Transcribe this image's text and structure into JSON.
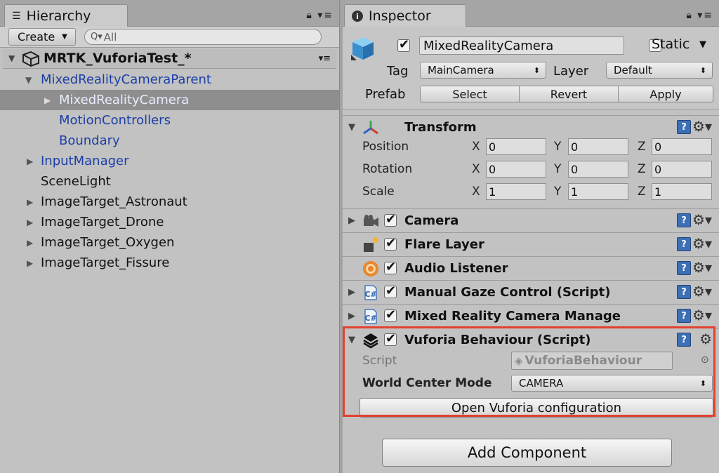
{
  "hierarchy": {
    "tab_label": "Hierarchy",
    "create_label": "Create",
    "search_placeholder": "All",
    "scene_name": "MRTK_VuforiaTest_*",
    "items": [
      {
        "label": "MixedRealityCameraParent",
        "expanded": true
      },
      {
        "label": "MixedRealityCamera",
        "selected": true
      },
      {
        "label": "MotionControllers"
      },
      {
        "label": "Boundary"
      },
      {
        "label": "InputManager"
      },
      {
        "label": "SceneLight"
      },
      {
        "label": "ImageTarget_Astronaut"
      },
      {
        "label": "ImageTarget_Drone"
      },
      {
        "label": "ImageTarget_Oxygen"
      },
      {
        "label": "ImageTarget_Fissure"
      }
    ]
  },
  "inspector": {
    "tab_label": "Inspector",
    "object_name": "MixedRealityCamera",
    "active": true,
    "static_label": "Static",
    "tag_label": "Tag",
    "tag_value": "MainCamera",
    "layer_label": "Layer",
    "layer_value": "Default",
    "prefab_label": "Prefab",
    "prefab_buttons": [
      "Select",
      "Revert",
      "Apply"
    ],
    "transform": {
      "title": "Transform",
      "rows": [
        {
          "label": "Position",
          "x": "0",
          "y": "0",
          "z": "0"
        },
        {
          "label": "Rotation",
          "x": "0",
          "y": "0",
          "z": "0"
        },
        {
          "label": "Scale",
          "x": "1",
          "y": "1",
          "z": "1"
        }
      ],
      "axis_labels": [
        "X",
        "Y",
        "Z"
      ]
    },
    "components": [
      {
        "title": "Camera",
        "icon": "camera-icon",
        "enabled": true
      },
      {
        "title": "Flare Layer",
        "icon": "flare-layer-icon",
        "enabled": true
      },
      {
        "title": "Audio Listener",
        "icon": "audio-listener-icon",
        "enabled": true
      },
      {
        "title": "Manual Gaze Control (Script)",
        "icon": "csharp-script-icon",
        "enabled": true
      },
      {
        "title": "Mixed Reality Camera Manage",
        "icon": "csharp-script-icon",
        "enabled": true
      }
    ],
    "vuforia": {
      "title": "Vuforia Behaviour (Script)",
      "icon": "vuforia-icon",
      "enabled": true,
      "script_label": "Script",
      "script_value": "VuforiaBehaviour",
      "world_center_label": "World Center Mode",
      "world_center_value": "CAMERA",
      "open_config_label": "Open Vuforia configuration"
    },
    "add_component_label": "Add Component"
  },
  "colors": {
    "highlight_border": "#e2412e",
    "hierarchy_link_blue": "#1b3fa6",
    "selection_bg": "#8e8e8e"
  }
}
